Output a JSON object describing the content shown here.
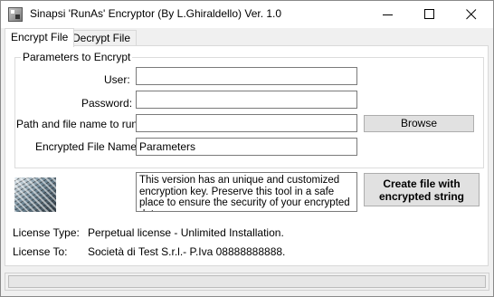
{
  "window": {
    "title": "Sinapsi 'RunAs' Encryptor (By L.Ghiraldello) Ver. 1.0"
  },
  "tabs": [
    {
      "label": "Encrypt File",
      "active": true
    },
    {
      "label": "Decrypt File",
      "active": false
    }
  ],
  "parameters": {
    "group_title": "Parameters to Encrypt",
    "user_label": "User:",
    "user_value": "",
    "password_label": "Password:",
    "password_value": "",
    "path_label": "Path and file name to run:",
    "path_value": "",
    "browse_label": "Browse",
    "encrypted_name_label": "Encrypted File Name:",
    "encrypted_name_value": "Parameters"
  },
  "info": {
    "text": "This version has an unique and customized encryption key. Preserve this tool in a safe place to ensure the security of your encrypted data."
  },
  "create_button": {
    "line1": "Create file with",
    "line2": "encrypted string"
  },
  "license": {
    "type_label": "License Type:",
    "type_value": "Perpetual license - Unlimited Installation.",
    "to_label": "License To:",
    "to_value": "Società di Test S.r.l.- P.Iva 08888888888."
  },
  "icons": {
    "app": "app-icon",
    "minimize": "minimize-icon",
    "maximize": "maximize-icon",
    "close": "close-icon",
    "logo": "logo-image"
  }
}
